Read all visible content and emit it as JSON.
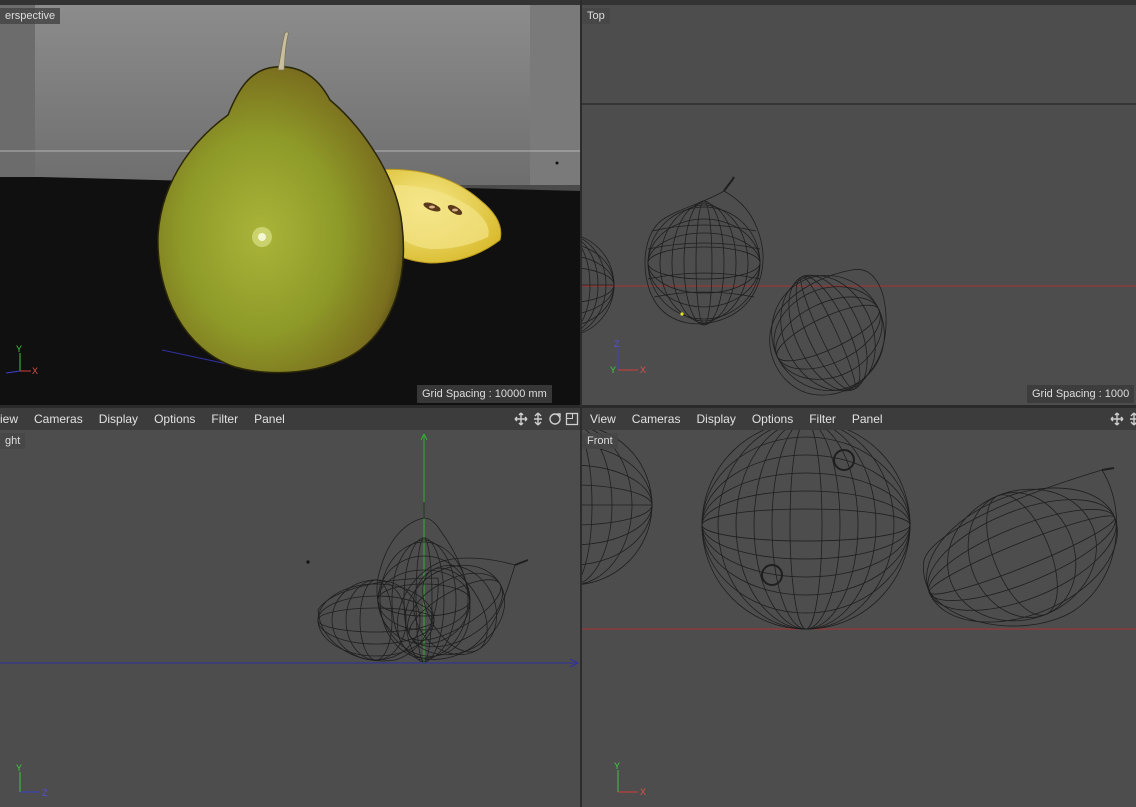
{
  "viewports": {
    "perspective": {
      "label": "erspective",
      "grid_spacing": "Grid Spacing : 10000 mm",
      "axes": {
        "y": "Y",
        "x": "X"
      }
    },
    "top": {
      "label": "Top",
      "grid_spacing": "Grid Spacing : 1000",
      "axes": {
        "z": "Z",
        "y": "Y",
        "x": "X"
      }
    },
    "right": {
      "label": "ght",
      "axes": {
        "y": "Y",
        "z": "Z"
      },
      "menu": [
        "iew",
        "Cameras",
        "Display",
        "Options",
        "Filter",
        "Panel"
      ]
    },
    "front": {
      "label": "Front",
      "axes": {
        "y": "Y",
        "x": "X"
      },
      "menu": [
        "View",
        "Cameras",
        "Display",
        "Options",
        "Filter",
        "Panel"
      ]
    }
  },
  "nav_icons": [
    "move-view-icon",
    "zoom-view-icon",
    "rotate-view-icon",
    "maximize-view-icon"
  ],
  "colors": {
    "viewport_bg": "#4d4d4d",
    "menubar_bg": "#3c3c3c",
    "wire": "#1f1f1f",
    "axis_x": "#d23c3c",
    "axis_y": "#3cc83c",
    "axis_z": "#4040d0"
  }
}
